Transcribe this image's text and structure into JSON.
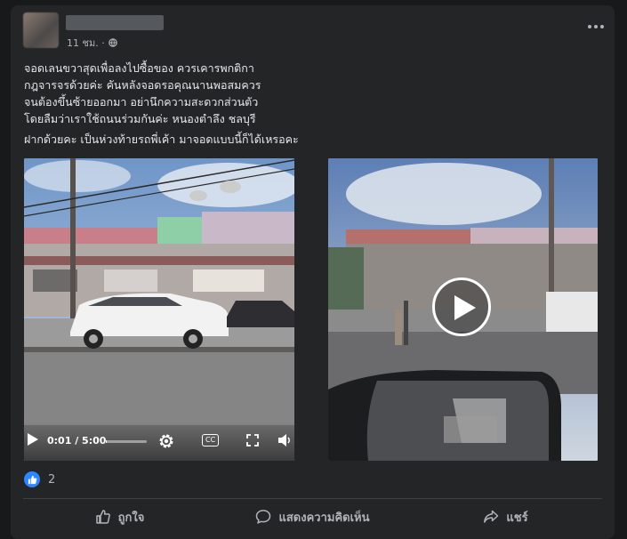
{
  "post": {
    "time": "11 ชม. ·",
    "privacy_icon": "globe-icon",
    "text_lines": "จอดเลนขวาสุดเพื่อลงไปซื้อของ ควรเคารพกติกา\nกฎจารจรด้วยค่ะ คันหลังจอดรอคุณนานพอสมควร\nจนต้องขึ้นซ้ายออกมา   อย่านึกความสะดวกส่วนตัว\nโดยลืมว่าเราใช้ถนนร่วมกันค่ะ หนองตำลึง ชลบุรี",
    "text_second": "ฝากด้วยคะ เป็นห่วงท้ายรถพี่เค้า มาจอดแบบนี้ก็ได้เหรอคะ"
  },
  "video": {
    "time_label": "0:01 / 5:00",
    "progress_fraction": 0.003,
    "play_icon": "play-icon",
    "settings_icon": "gear-icon",
    "captions_label": "CC",
    "fullscreen_icon": "fullscreen-icon",
    "volume_icon": "volume-icon"
  },
  "reactions": {
    "count": "2",
    "icon": "like-icon",
    "accent": "#2d88ff"
  },
  "actions": {
    "like": "ถูกใจ",
    "comment": "แสดงความคิดเห็น",
    "share": "แชร์"
  },
  "colors": {
    "background": "#18191a",
    "card": "#242526",
    "text": "#e4e6eb",
    "secondary": "#b0b3b8"
  }
}
